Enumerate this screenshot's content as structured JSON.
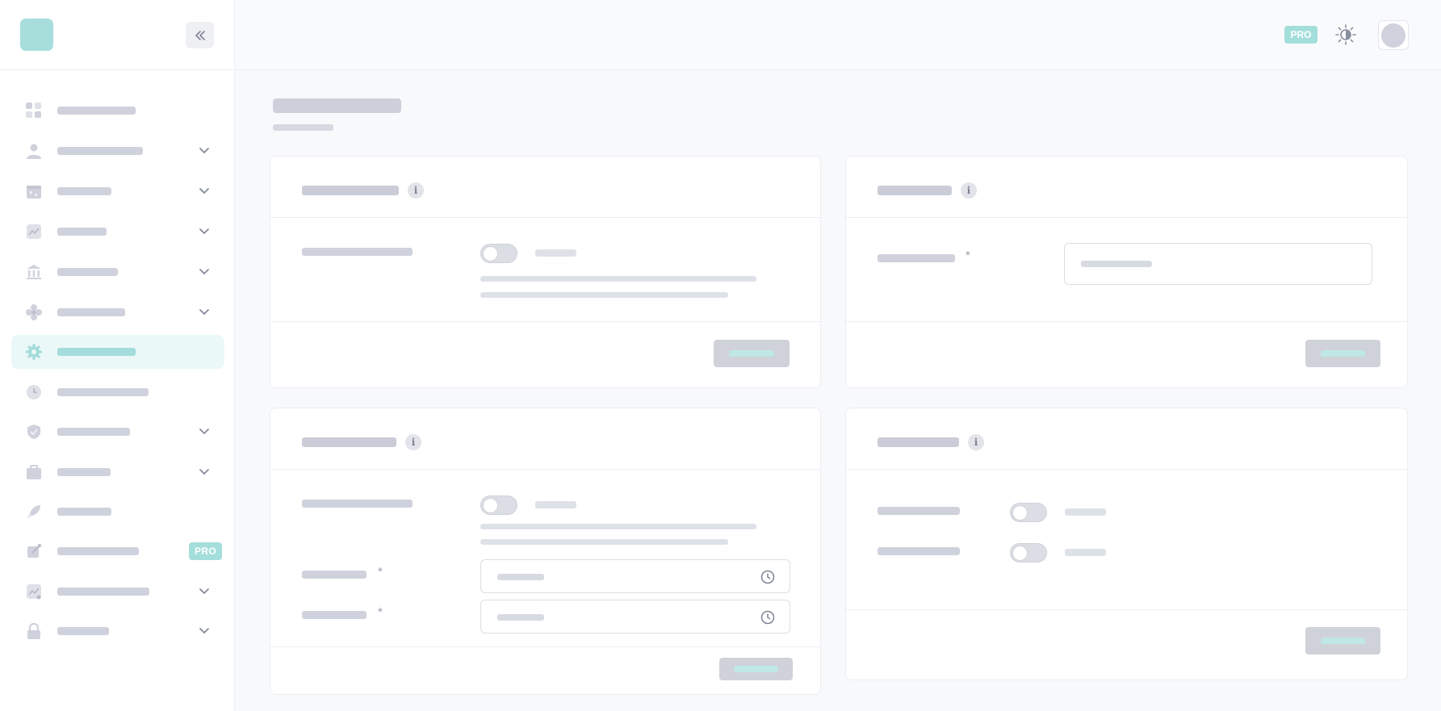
{
  "topbar": {
    "pro_badge": "PRO",
    "theme_icon": "sun-moon-icon",
    "avatar_icon": "avatar"
  },
  "sidebar": {
    "logo": "logo",
    "collapse_icon": "chevrons-left-icon",
    "items": [
      {
        "name": "dashboard",
        "icon": "grid-icon",
        "has_chevron": false,
        "active": false
      },
      {
        "name": "users",
        "icon": "user-icon",
        "has_chevron": true,
        "active": false
      },
      {
        "name": "calendar",
        "icon": "calendar-icon",
        "has_chevron": true,
        "active": false
      },
      {
        "name": "analytics",
        "icon": "chart-icon",
        "has_chevron": true,
        "active": false
      },
      {
        "name": "bank",
        "icon": "bank-icon",
        "has_chevron": true,
        "active": false
      },
      {
        "name": "integrations",
        "icon": "flower-icon",
        "has_chevron": true,
        "active": false
      },
      {
        "name": "settings",
        "icon": "gear-icon",
        "has_chevron": false,
        "active": true
      },
      {
        "name": "history",
        "icon": "clock-icon",
        "has_chevron": false,
        "active": false
      },
      {
        "name": "security",
        "icon": "shield-icon",
        "has_chevron": true,
        "active": false
      },
      {
        "name": "jobs",
        "icon": "briefcase-icon",
        "has_chevron": true,
        "active": false
      },
      {
        "name": "launch",
        "icon": "rocket-icon",
        "has_chevron": false,
        "active": false
      },
      {
        "name": "pro-feature",
        "icon": "pin-icon",
        "has_chevron": false,
        "active": false,
        "badge": "PRO"
      },
      {
        "name": "reports",
        "icon": "trend-icon",
        "has_chevron": true,
        "active": false
      },
      {
        "name": "privacy",
        "icon": "lock-icon",
        "has_chevron": true,
        "active": false
      }
    ]
  },
  "cards": {
    "required_mark": "*",
    "info_glyph": "i"
  },
  "colors": {
    "accent": "#a4dedb",
    "active_bg": "#ebf8f8",
    "skeleton": "#cfd2dc",
    "page_bg": "#f8f9fb"
  }
}
